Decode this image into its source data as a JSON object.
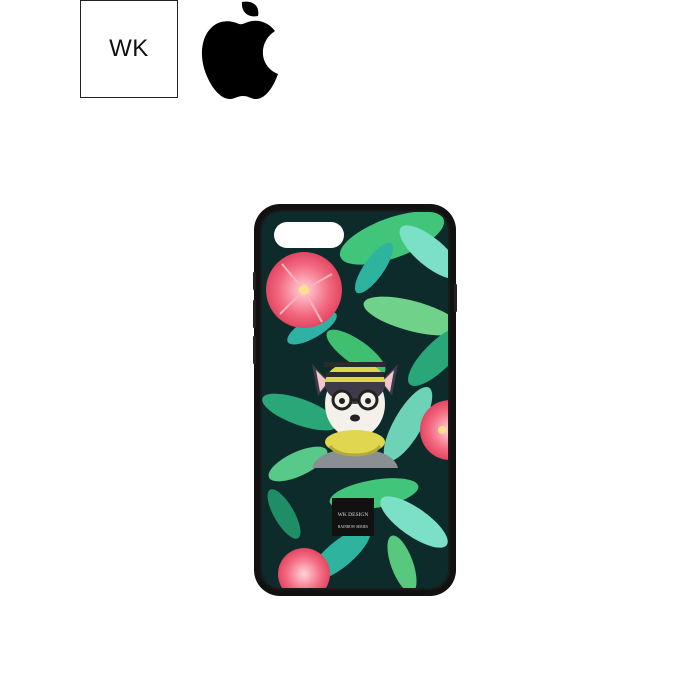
{
  "brand": {
    "wk_label": "WK",
    "apple_logo_icon": "apple-logo-icon"
  },
  "product": {
    "badge_title": "WK DESIGN",
    "badge_subtitle": "RAINBOW SERIES"
  },
  "colors": {
    "case_frame": "#111111",
    "background_dark": "#0d2b2a",
    "leaf_green": "#3fbf6f",
    "leaf_teal": "#2fb1a6",
    "flower_red": "#e84a5f",
    "beanie_yellow": "#d9d84a"
  }
}
